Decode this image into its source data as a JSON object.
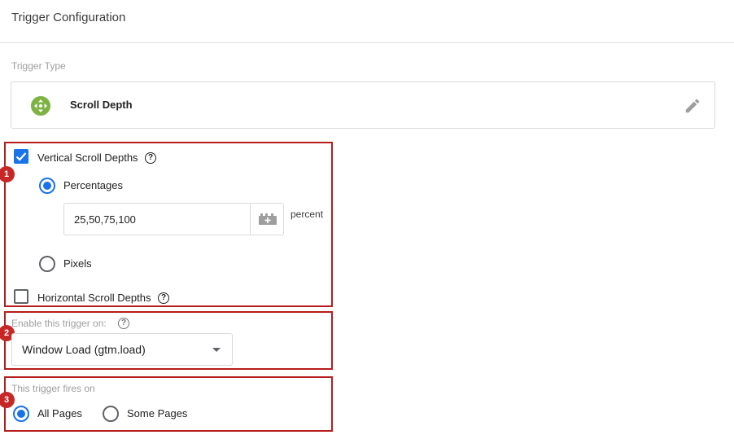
{
  "header": {
    "title": "Trigger Configuration"
  },
  "trigger_type": {
    "label": "Trigger Type",
    "name": "Scroll Depth",
    "icon": "scroll-arrows-icon",
    "icon_color": "#7cb342"
  },
  "callouts": {
    "one": "1",
    "two": "2",
    "three": "3",
    "color": "#b71c1c"
  },
  "vertical": {
    "label": "Vertical Scroll Depths",
    "checked": true,
    "percentages_label": "Percentages",
    "percentages_value": "25,50,75,100",
    "unit": "percent",
    "pixels_label": "Pixels"
  },
  "horizontal": {
    "label": "Horizontal Scroll Depths",
    "checked": false
  },
  "enable": {
    "label": "Enable this trigger on:",
    "selected": "Window Load (gtm.load)"
  },
  "fires": {
    "label": "This trigger fires on",
    "all_label": "All Pages",
    "some_label": "Some Pages",
    "selected": "All Pages"
  },
  "help_glyph": "?",
  "accent_color": "#1a73e8"
}
